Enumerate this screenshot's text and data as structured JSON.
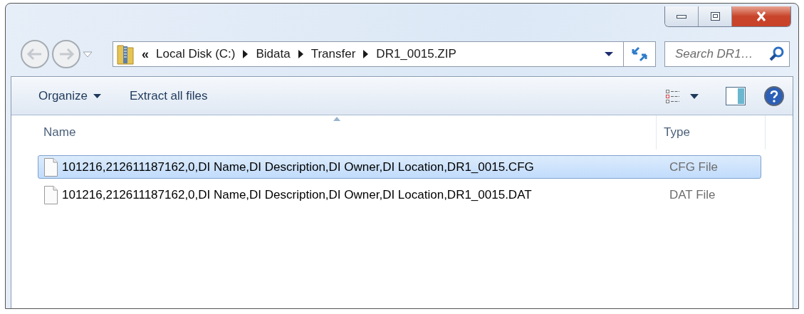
{
  "address": {
    "overflow": "«",
    "crumbs": [
      "Local Disk (C:)",
      "Bidata",
      "Transfer",
      "DR1_0015.ZIP"
    ]
  },
  "search": {
    "placeholder": "Search DR1…"
  },
  "toolbar": {
    "buttons": [
      {
        "label": "Organize",
        "kind": "dropdown"
      },
      {
        "label": "Extract all files",
        "kind": "plain"
      }
    ]
  },
  "columns": [
    {
      "label": "Name",
      "sorted": true
    },
    {
      "label": "Type",
      "sorted": false
    }
  ],
  "rows": [
    {
      "name": "101216,212611187162,0,DI Name,DI Description,DI Owner,DI Location,DR1_0015.CFG",
      "type": "CFG File",
      "selected": true
    },
    {
      "name": "101216,212611187162,0,DI Name,DI Description,DI Owner,DI Location,DR1_0015.DAT",
      "type": "DAT File",
      "selected": false
    }
  ]
}
